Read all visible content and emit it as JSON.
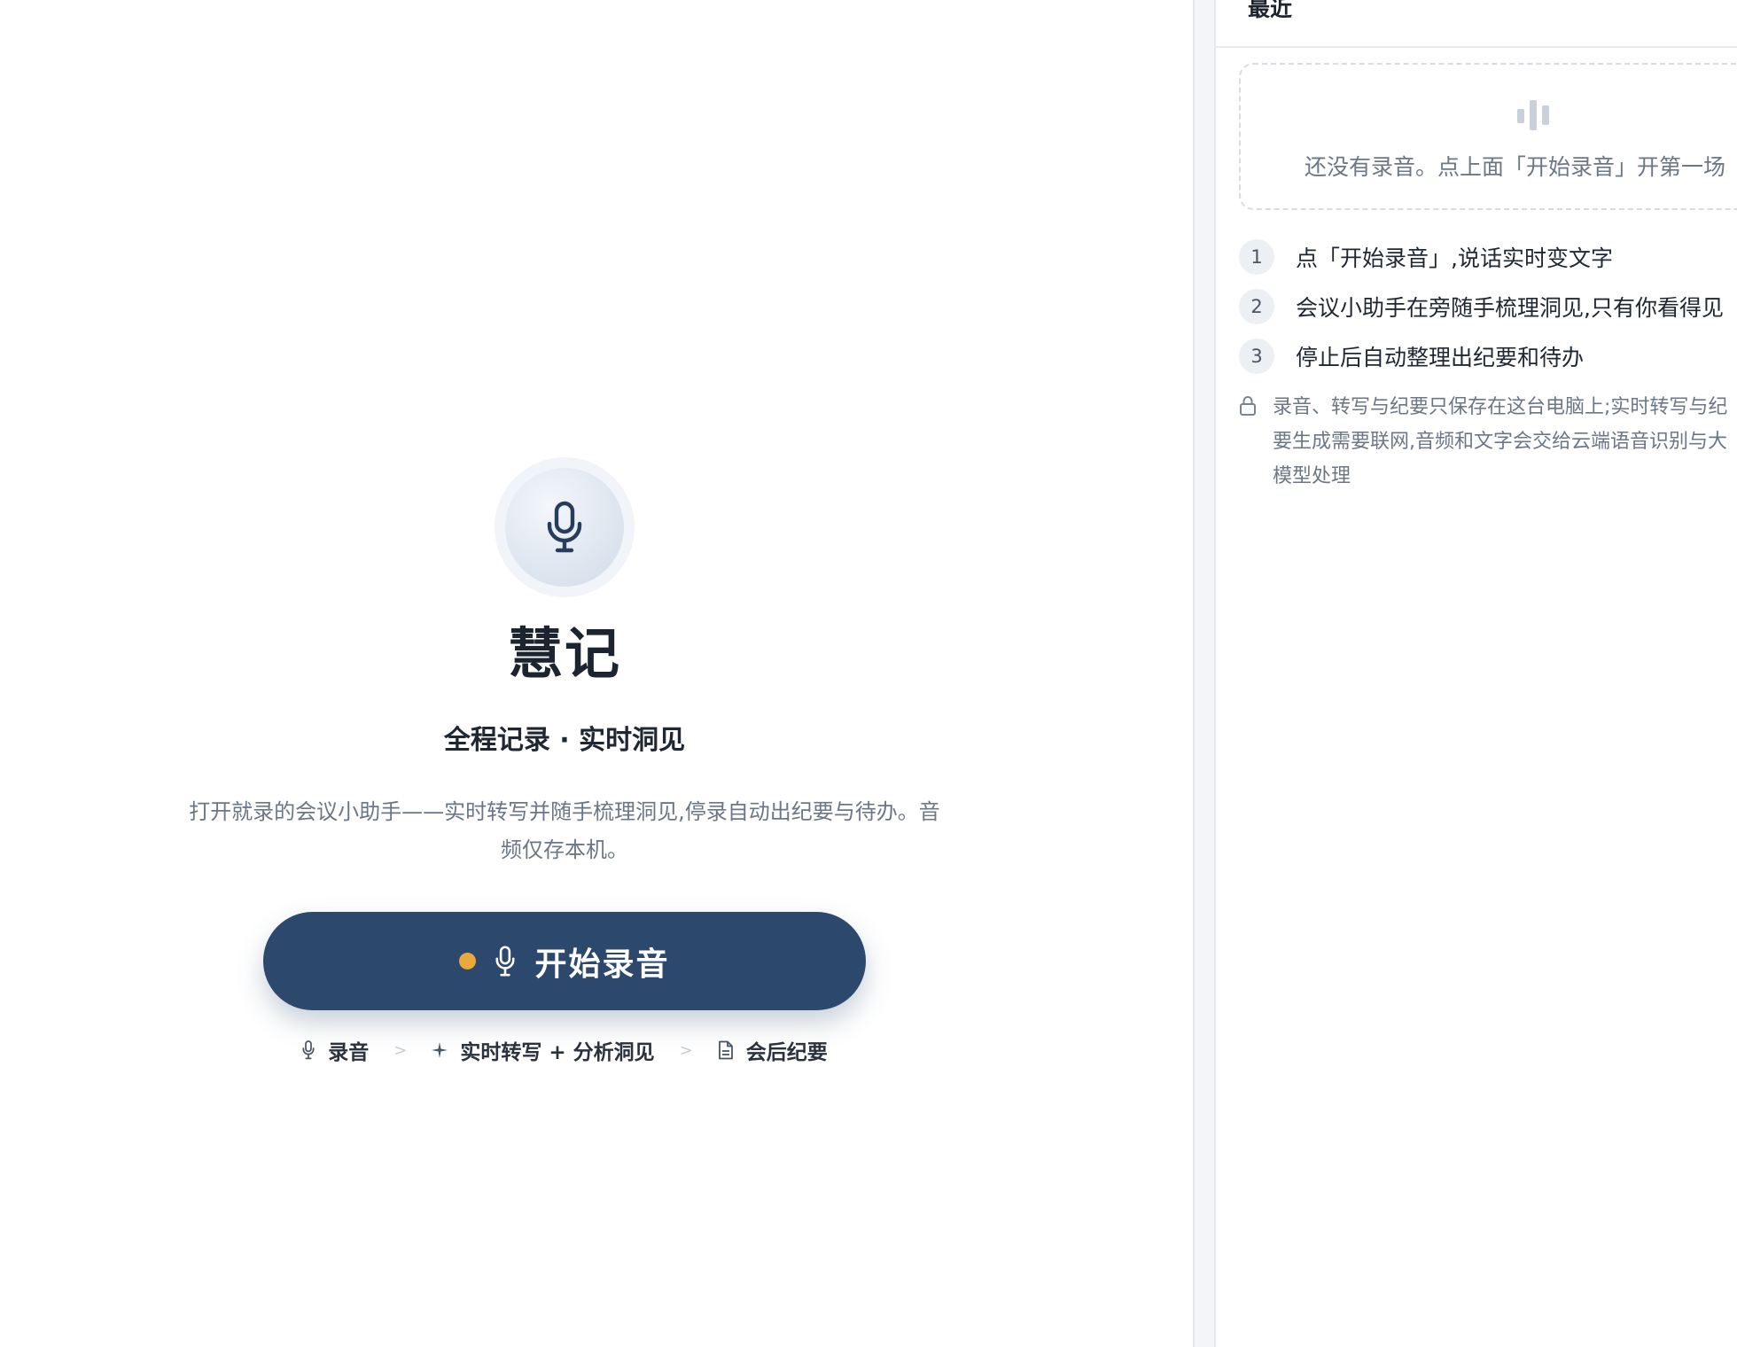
{
  "main": {
    "title": "慧记",
    "subtitle": "全程记录 · 实时洞见",
    "description": "打开就录的会议小助手——实时转写并随手梳理洞见,停录自动出纪要与待办。音频仅存本机。",
    "start_button_label": "开始录音",
    "flow": [
      {
        "label": "录音",
        "icon": "mic-icon"
      },
      {
        "label": "实时转写 + 分析洞见",
        "icon": "sparkle-icon"
      },
      {
        "label": "会后纪要",
        "icon": "document-icon"
      }
    ],
    "flow_separator": ">"
  },
  "sidebar": {
    "title": "最近",
    "empty_text": "还没有录音。点上面「开始录音」开第一场",
    "steps": [
      {
        "num": "1",
        "text": "点「开始录音」,说话实时变文字"
      },
      {
        "num": "2",
        "text": "会议小助手在旁随手梳理洞见,只有你看得见"
      },
      {
        "num": "3",
        "text": "停止后自动整理出纪要和待办"
      }
    ],
    "privacy_text": "录音、转写与纪要只保存在这台电脑上;实时转写与纪要生成需要联网,音频和文字会交给云端语音识别与大模型处理"
  },
  "colors": {
    "primary": "#2c486c",
    "recording_dot": "#eaa93b",
    "text_dark": "#1c2430",
    "text_muted": "#6b7786"
  }
}
